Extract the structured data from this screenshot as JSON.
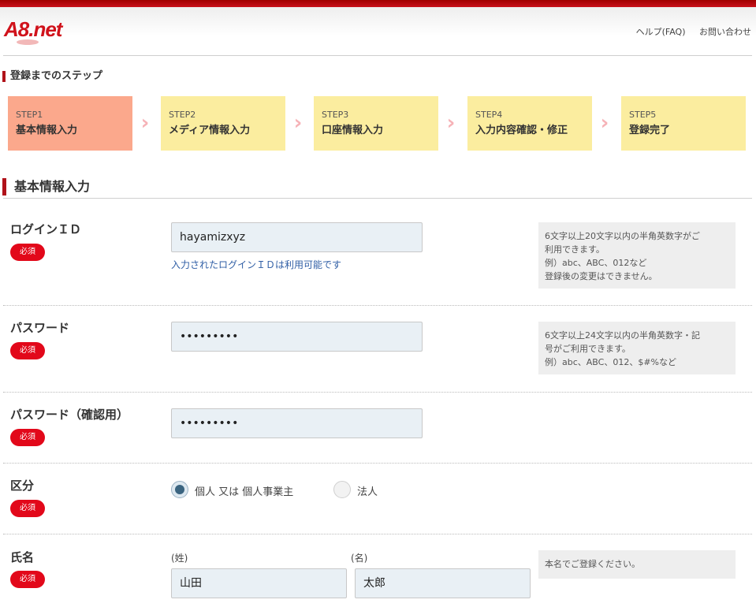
{
  "header": {
    "logo_text": "A8.net",
    "links": [
      "ヘルプ(FAQ)",
      "お問い合わせ"
    ]
  },
  "steps": {
    "title": "登録までのステップ",
    "items": [
      {
        "num": "STEP1",
        "name": "基本情報入力"
      },
      {
        "num": "STEP2",
        "name": "メディア情報入力"
      },
      {
        "num": "STEP3",
        "name": "口座情報入力"
      },
      {
        "num": "STEP4",
        "name": "入力内容確認・修正"
      },
      {
        "num": "STEP5",
        "name": "登録完了"
      }
    ],
    "active_color": "#fba88c",
    "inactive_color": "#fbed9f"
  },
  "section": {
    "title": "基本情報入力"
  },
  "required_label": "必須",
  "login_id": {
    "label": "ログインＩＤ",
    "value": "hayamizxyz",
    "status": "入力されたログインＩＤは利用可能です",
    "help": [
      "6文字以上20文字以内の半角英数字がご",
      "利用できます。",
      "例）abc、ABC、012など",
      "登録後の変更はできません。"
    ]
  },
  "password": {
    "label": "パスワード",
    "value": "•••••••••",
    "help": [
      "6文字以上24文字以内の半角英数字・記",
      "号がご利用できます。",
      "例）abc、ABC、012、$#%など"
    ]
  },
  "password_confirm": {
    "label": "パスワード（確認用）",
    "value": "•••••••••"
  },
  "category": {
    "label": "区分",
    "options": [
      "個人 又は 個人事業主",
      "法人"
    ],
    "selected": "個人 又は 個人事業主"
  },
  "name": {
    "label": "氏名",
    "last_label": "(姓)",
    "first_label": "(名)",
    "last_value": "山田",
    "first_value": "太郎",
    "help": "本名でご登録ください。"
  }
}
